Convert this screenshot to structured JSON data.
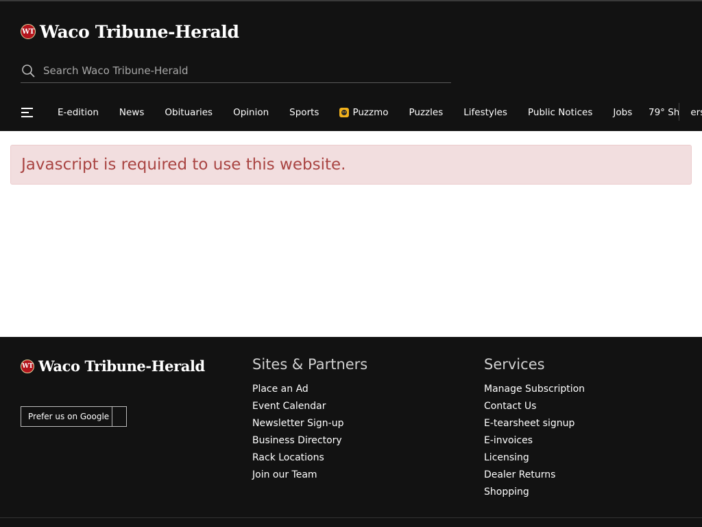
{
  "header": {
    "brand": {
      "seal": "WT",
      "name": "Waco Tribune-Herald"
    },
    "search": {
      "placeholder": "Search Waco Tribune-Herald"
    },
    "nav": {
      "items": [
        {
          "label": "E-edition"
        },
        {
          "label": "News"
        },
        {
          "label": "Obituaries"
        },
        {
          "label": "Opinion"
        },
        {
          "label": "Sports"
        },
        {
          "label": "Puzzmo",
          "icon": "puzzmo-icon"
        },
        {
          "label": "Puzzles"
        },
        {
          "label": "Lifestyles"
        },
        {
          "label": "Public Notices"
        },
        {
          "label": "Jobs"
        }
      ],
      "weather": "79° Sh",
      "weather_overflow": "ers"
    }
  },
  "alert": {
    "message": "Javascript is required to use this website."
  },
  "footer": {
    "brand": {
      "seal": "WT",
      "name": "Waco Tribune-Herald"
    },
    "prefer_button": "Prefer us on Google",
    "sites": {
      "heading": "Sites & Partners",
      "links": [
        "Place an Ad",
        "Event Calendar",
        "Newsletter Sign-up",
        "Business Directory",
        "Rack Locations",
        "Join our Team"
      ]
    },
    "services": {
      "heading": "Services",
      "links": [
        "Manage Subscription",
        "Contact Us",
        "E-tearsheet signup",
        "E-invoices",
        "Licensing",
        "Dealer Returns",
        "Shopping"
      ]
    }
  },
  "colors": {
    "header_bg": "#121212",
    "alert_bg": "#f2dedf",
    "alert_text": "#a94442",
    "seal": "#b3141c"
  }
}
